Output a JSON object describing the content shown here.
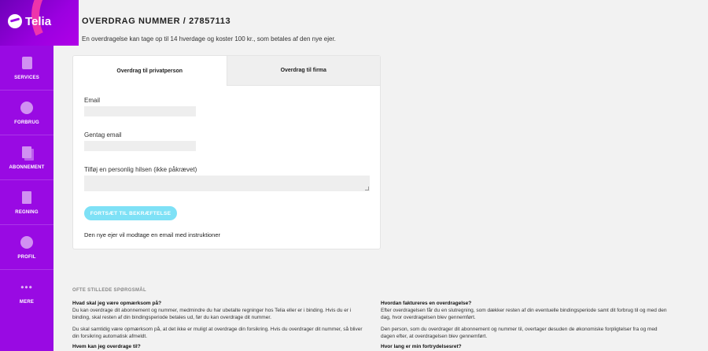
{
  "brand": {
    "name": "Telia",
    "accent": "#990ae3",
    "button": "#7ee1f6"
  },
  "sidebar": {
    "items": [
      {
        "label": "SERVICES",
        "icon": "services-icon"
      },
      {
        "label": "FORBRUG",
        "icon": "pie-chart-icon"
      },
      {
        "label": "ABONNEMENT",
        "icon": "subscription-icon"
      },
      {
        "label": "REGNING",
        "icon": "invoice-icon"
      },
      {
        "label": "PROFIL",
        "icon": "profile-icon"
      },
      {
        "label": "MERE",
        "icon": "more-icon"
      }
    ]
  },
  "page": {
    "title": "OVERDRAG NUMMER / 27857113",
    "intro": "En overdragelse kan tage op til 14 hverdage og koster 100 kr., som betales af den nye ejer."
  },
  "tabs": [
    {
      "label": "Overdrag til privatperson",
      "active": true
    },
    {
      "label": "Overdrag til firma",
      "active": false
    }
  ],
  "form": {
    "email_label": "Email",
    "email_value": "",
    "repeat_email_label": "Gentag email",
    "repeat_email_value": "",
    "greeting_label": "Tilføj en personlig hilsen (ikke påkrævet)",
    "greeting_value": "",
    "submit_label": "FORTSÆT TIL BEKRÆFTELSE",
    "info": "Den nye ejer vil modtage en email med instruktioner"
  },
  "faq": {
    "heading": "OFTE STILLEDE SPØRGSMÅL",
    "left": [
      {
        "q": "Hvad skal jeg være opmærksom på?",
        "p": [
          "Du kan overdrage dit abonnement og nummer, medmindre du har ubetalte regninger hos Telia eller er i binding. Hvis du er i binding, skal resten af din bindingsperiode betales ud, før du kan overdrage dit nummer.",
          "Du skal samtidig være opmærksom på, at det ikke er muligt at overdrage din forsikring. Hvis du overdrager dit nummer, så bliver din forsikring automatisk afmeldt."
        ]
      },
      {
        "q": "Hvem kan jeg overdrage til?",
        "p": []
      }
    ],
    "right": [
      {
        "q": "Hvordan faktureres en overdragelse?",
        "p": [
          "Efter overdragelsen får du en slutregning, som dækker resten af din eventuelle bindingsperiode samt dit forbrug til og med den dag, hvor overdragelsen blev gennemført.",
          "Den person, som du overdrager dit abonnement og nummer til, overtager desuden de økonomiske forpligtelser fra og med dagen efter, at overdragelsen blev gennemført."
        ]
      },
      {
        "q": "Hvor lang er min fortrydelsesret?",
        "p": []
      }
    ]
  }
}
